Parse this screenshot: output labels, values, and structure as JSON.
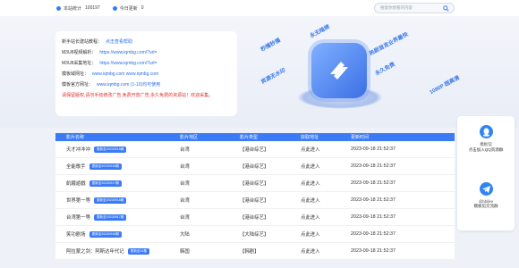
{
  "topbar": {
    "stat_total_label": "本站统计",
    "stat_total_value": "100197",
    "stat_today_label": "今日更新",
    "stat_today_value": "0",
    "search_placeholder": "搜索你想看的内容"
  },
  "info": {
    "tutorial_label": "新手站长建站教程：",
    "tutorial_link": "点击查看帮助",
    "m3u8_video_label": "M3U8视频解析：",
    "m3u8_video_url": "https://www.iqmbg.com/?url=",
    "m3u8_collect_label": "M3U8采集地址：",
    "m3u8_collect_url": "https://www.iqmbg.com/?url=",
    "site_domain_label": "模板域网址：",
    "site_domain_value": "www.iqmbg.com    www.iqmbg.com",
    "backup_label": "模板官方网址：",
    "backup_value": "www.iqmbg.com    (1-10)均可使用",
    "notice": "请保留版权,请勿手动修改广告,免费开放广告,永久免费的资源站！欢迎采集。"
  },
  "hero_tags": [
    "秒播秒播",
    "永无暗牌",
    "热剧首发业界最快",
    "资源无水印",
    "永久免费",
    "1080P 超高清"
  ],
  "table": {
    "headers": [
      "影片名称",
      "影片地区",
      "影片类型",
      "获取地址",
      "更新时间"
    ],
    "rows": [
      {
        "name": "天才冲冲冲",
        "badge": "更新至20230918期",
        "region": "台湾",
        "type": "【港台综艺】",
        "action": "点此进入",
        "time": "2023-09-18 21:52:37"
      },
      {
        "name": "全能歌手",
        "badge": "更新至20230918期",
        "region": "台湾",
        "type": "【港台综艺】",
        "action": "点此进入",
        "time": "2023-09-18 21:52:37"
      },
      {
        "name": "飢餓遊戲",
        "badge": "更新至20230917期",
        "region": "台湾",
        "type": "【港台综艺】",
        "action": "点此进入",
        "time": "2023-09-18 21:52:37"
      },
      {
        "name": "世界第一等",
        "badge": "更新至20230918期",
        "region": "台湾",
        "type": "【港台综艺】",
        "action": "点此进入",
        "time": "2023-09-18 21:52:37"
      },
      {
        "name": "台湾第一等",
        "badge": "更新至20230917期",
        "region": "台湾",
        "type": "【港台综艺】",
        "action": "点此进入",
        "time": "2023-09-18 21:52:37"
      },
      {
        "name": "笑功剧场",
        "badge": "更新至20230918期",
        "region": "大陆",
        "type": "【大陆综艺】",
        "action": "点此进入",
        "time": "2023-09-18 21:52:37"
      },
      {
        "name": "阿拉蒙之剑：阿斯达年代记",
        "badge": "更新至24集",
        "region": "韩国",
        "type": "【韩剧】",
        "action": "点此进入",
        "time": "2023-09-18 21:52:37"
      }
    ]
  },
  "side": {
    "qq_title": "模板馆",
    "qq_desc": "点击加入QQ资源群",
    "tg_title": "@bblike",
    "tg_desc": "模板馆交流群"
  },
  "colors": {
    "accent": "#3b7bf6",
    "notice": "#e03030"
  }
}
